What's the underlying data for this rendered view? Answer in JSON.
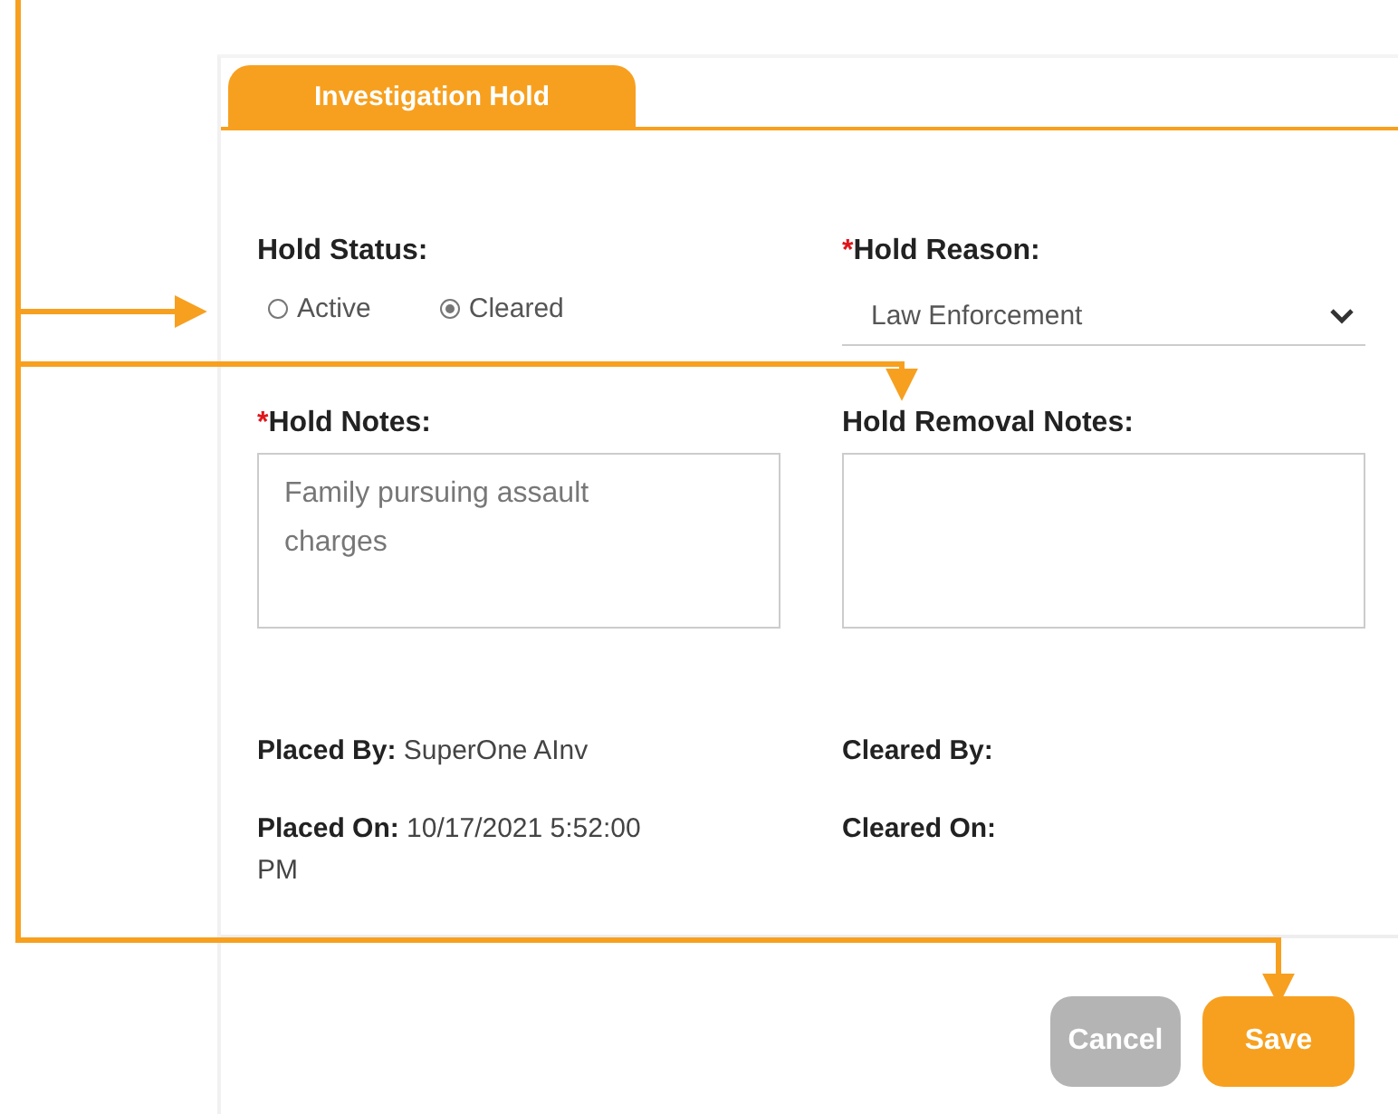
{
  "tab": {
    "label": "Investigation Hold",
    "selected": true
  },
  "hold_status": {
    "label": "Hold Status:",
    "options": [
      {
        "label": "Active",
        "selected": false
      },
      {
        "label": "Cleared",
        "selected": true
      }
    ]
  },
  "hold_reason": {
    "required_mark": "*",
    "label": "Hold Reason:",
    "value": "Law Enforcement"
  },
  "hold_notes": {
    "required_mark": "*",
    "label": "Hold Notes:",
    "value": "Family pursuing assault charges"
  },
  "hold_removal_notes": {
    "label": "Hold Removal Notes:"
  },
  "details": [
    {
      "label": "Placed By:",
      "value": "SuperOne AInv"
    },
    {
      "label": "Cleared By:"
    },
    {
      "label": "Placed On:",
      "value": "10/17/2021 5:52:00 PM"
    },
    {
      "label": "Cleared On:"
    }
  ],
  "buttons": [
    {
      "label": "Cancel",
      "kind": "secondary",
      "disabled": true
    },
    {
      "label": "Save",
      "kind": "primary",
      "disabled": false
    }
  ]
}
